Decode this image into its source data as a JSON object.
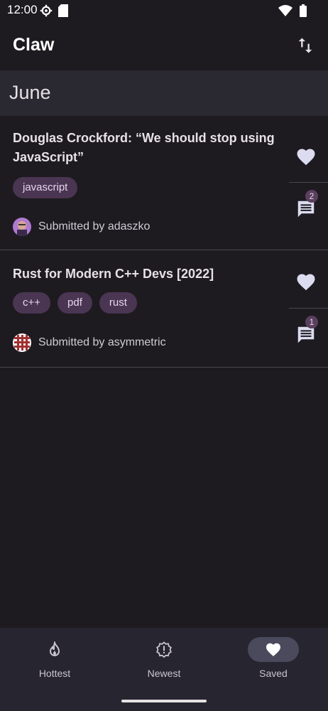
{
  "status": {
    "time": "12:00"
  },
  "app": {
    "title": "Claw"
  },
  "section": {
    "title": "June"
  },
  "posts": [
    {
      "title": "Douglas Crockford: “We should stop using JavaScript”",
      "tags": [
        "javascript"
      ],
      "submitted": "Submitted by adaszko",
      "comment_count": "2"
    },
    {
      "title": "Rust for Modern C++ Devs [2022]",
      "tags": [
        "c++",
        "pdf",
        "rust"
      ],
      "submitted": "Submitted by asymmetric",
      "comment_count": "1"
    }
  ],
  "nav": {
    "items": [
      {
        "label": "Hottest",
        "icon": "flame-icon"
      },
      {
        "label": "Newest",
        "icon": "alert-badge-icon"
      },
      {
        "label": "Saved",
        "icon": "heart-icon"
      }
    ]
  },
  "colors": {
    "background": "#1d1b20",
    "tag": "#4a3552",
    "accent_pill": "#4a4a5c"
  }
}
